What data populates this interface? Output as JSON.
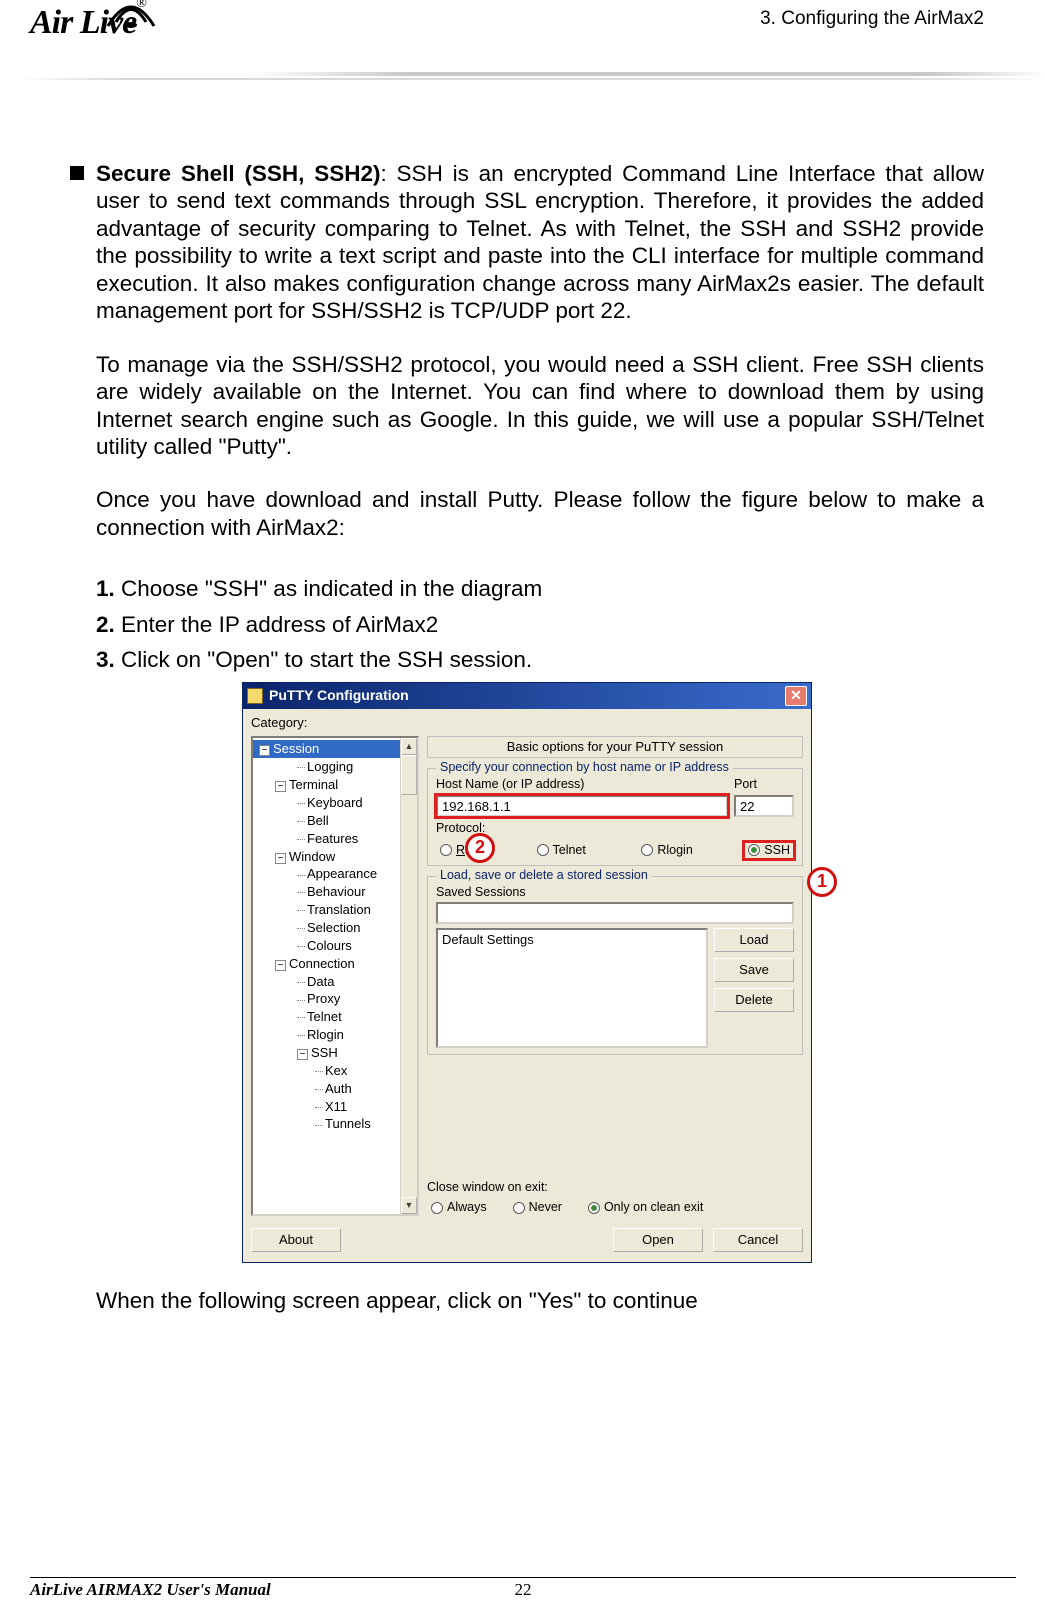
{
  "header": {
    "chapter": "3. Configuring the AirMax2",
    "logo_text": "Air Live",
    "reg": "®"
  },
  "content": {
    "bullet_title": "Secure Shell (SSH, SSH2)",
    "bullet_body": ":   SSH is an encrypted Command Line Interface that allow user to send text commands through SSL encryption.   Therefore, it provides the added advantage of security comparing to Telnet.   As with Telnet, the SSH and SSH2 provide the possibility to write a text script and paste into the CLI interface for multiple command execution.   It also makes configuration change across many AirMax2s easier.   The default management port for SSH/SSH2 is TCP/UDP port 22.",
    "para2": "To manage via the SSH/SSH2 protocol, you would need a SSH client.   Free SSH clients are widely available on the Internet.   You can find where to download them by using Internet search engine such as Google.   In this guide, we will use a popular SSH/Telnet utility called \"Putty\".",
    "para3": "Once you have download and install Putty.   Please follow the figure below to make a connection with AirMax2:",
    "steps": [
      {
        "num": "1.",
        "text": " Choose \"SSH\" as indicated in the diagram"
      },
      {
        "num": "2.",
        "text": " Enter the IP address of AirMax2"
      },
      {
        "num": "3.",
        "text": " Click on \"Open\" to start the SSH session."
      }
    ],
    "after": "When the following screen appear, click on \"Yes\" to continue"
  },
  "putty": {
    "title": "PuTTY Configuration",
    "category_label": "Category:",
    "tree": {
      "session": "Session",
      "logging": "Logging",
      "terminal": "Terminal",
      "keyboard": "Keyboard",
      "bell": "Bell",
      "features": "Features",
      "window": "Window",
      "appearance": "Appearance",
      "behaviour": "Behaviour",
      "translation": "Translation",
      "selection": "Selection",
      "colours": "Colours",
      "connection": "Connection",
      "data": "Data",
      "proxy": "Proxy",
      "telnet": "Telnet",
      "rlogin": "Rlogin",
      "ssh": "SSH",
      "kex": "Kex",
      "auth": "Auth",
      "x11": "X11",
      "tunnels": "Tunnels"
    },
    "pane_header": "Basic options for your PuTTY session",
    "group1_title": "Specify your connection by host name or IP address",
    "host_label": "Host Name (or IP address)",
    "port_label": "Port",
    "host_value": "192.168.1.1",
    "port_value": "22",
    "protocol_label": "Protocol:",
    "proto_raw": "Raw",
    "proto_telnet": "Telnet",
    "proto_rlogin": "Rlogin",
    "proto_ssh": "SSH",
    "group2_title": "Load, save or delete a stored session",
    "saved_label": "Saved Sessions",
    "default_settings": "Default Settings",
    "btn_load": "Load",
    "btn_save": "Save",
    "btn_delete": "Delete",
    "exit_label": "Close window on exit:",
    "exit_always": "Always",
    "exit_never": "Never",
    "exit_clean": "Only on clean exit",
    "btn_about": "About",
    "btn_open": "Open",
    "btn_cancel": "Cancel"
  },
  "callouts": {
    "one": "1",
    "two": "2"
  },
  "footer": {
    "left": "AirLive AIRMAX2 User's Manual",
    "page": "22"
  }
}
